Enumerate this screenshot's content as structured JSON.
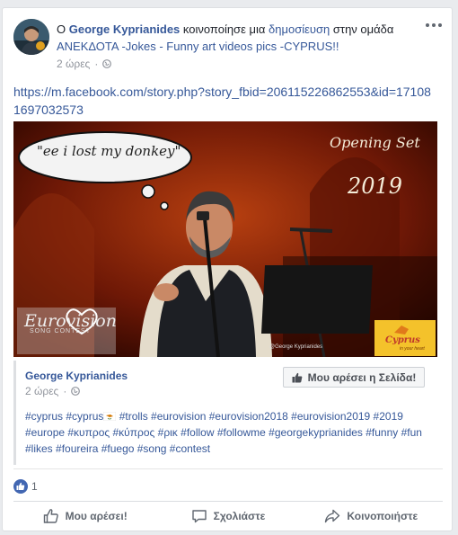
{
  "post": {
    "header": {
      "prefix": "Ο",
      "author": "George Kyprianides",
      "action": "κοινοποίησε μια",
      "object": "δημοσίευση",
      "in_group": "στην ομάδα",
      "group_name": "ΑΝΕΚΔΟΤΑ -Jokes - Funny art videos pics -CYPRUS!!"
    },
    "time": "2 ώρες",
    "link_text": "https://m.facebook.com/story.php?story_fbid=206115226862553&id=171081697032573",
    "image": {
      "speech_bubble": "\"ee i lost my donkey\"",
      "title": "Opening Set",
      "year": "2019",
      "credit": "@George Kyprianides",
      "eurovision_logo": "Eurovision",
      "eurovision_sub": "SONG CONTEST",
      "cyprus_logo": "Cyprus",
      "cyprus_sub": "in your heart"
    },
    "shared": {
      "author": "George Kyprianides",
      "time": "2 ώρες",
      "like_page_label": "Μου αρέσει η Σελίδα!",
      "hashtags_before_flag": "#cyprus #cyprus",
      "hashtags_after_flag": " #trolls #eurovision #eurovision2018 #eurovision2019 #2019 #europe #κυπρος #κύπρος #ρικ #follow #followme #georgekyprianides #funny #fun #likes #foureira #fuego #song #contest"
    },
    "reactions": {
      "count": "1"
    },
    "actions": {
      "like": "Μου αρέσει!",
      "comment": "Σχολιάστε",
      "share": "Κοινοποιήστε"
    }
  },
  "colors": {
    "link": "#365899",
    "meta": "#90949c",
    "like_blue": "#4267b2"
  },
  "icons": [
    "more-icon",
    "globe-icon",
    "thumbs-up-icon",
    "comment-icon",
    "share-icon",
    "cyprus-flag-icon"
  ]
}
